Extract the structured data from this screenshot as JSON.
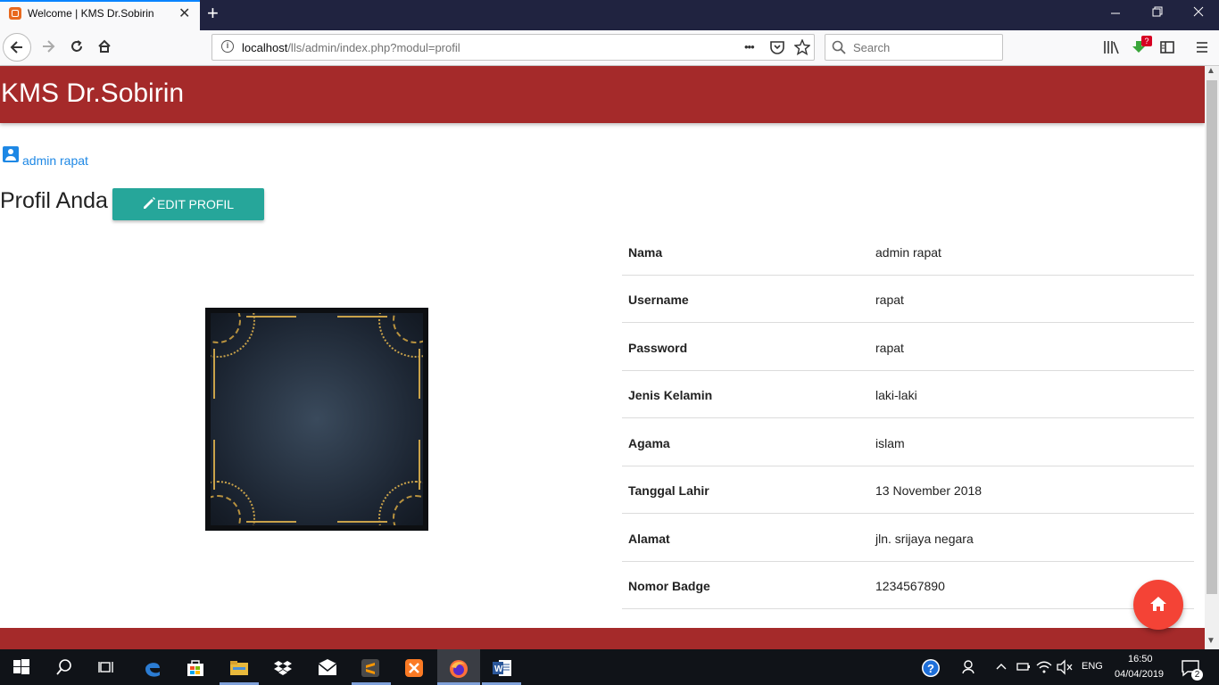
{
  "browser": {
    "tab_title": "Welcome | KMS Dr.Sobirin",
    "tab_close": "✕",
    "new_tab": "+",
    "url_host": "localhost",
    "url_path": "/lls/admin/index.php?modul=profil",
    "search_placeholder": "Search",
    "more_actions": "•••",
    "download_badge": "?"
  },
  "page": {
    "brand": "KMS Dr.Sobirin",
    "user_name": "admin rapat",
    "title": "Profil Anda",
    "edit_button": "EDIT PROFIL"
  },
  "profile": [
    {
      "label": "Nama",
      "value": "admin rapat"
    },
    {
      "label": "Username",
      "value": "rapat"
    },
    {
      "label": "Password",
      "value": "rapat"
    },
    {
      "label": "Jenis Kelamin",
      "value": "laki-laki"
    },
    {
      "label": "Agama",
      "value": "islam"
    },
    {
      "label": "Tanggal Lahir",
      "value": "13 November 2018"
    },
    {
      "label": "Alamat",
      "value": "jln. srijaya negara"
    },
    {
      "label": "Nomor Badge",
      "value": "1234567890"
    }
  ],
  "taskbar": {
    "time": "16:50",
    "date": "04/04/2019",
    "language": "ENG",
    "notifications": "2"
  },
  "colors": {
    "header": "#a52a2a",
    "button": "#26a69a",
    "fab": "#f44336",
    "link": "#1e88e5"
  }
}
